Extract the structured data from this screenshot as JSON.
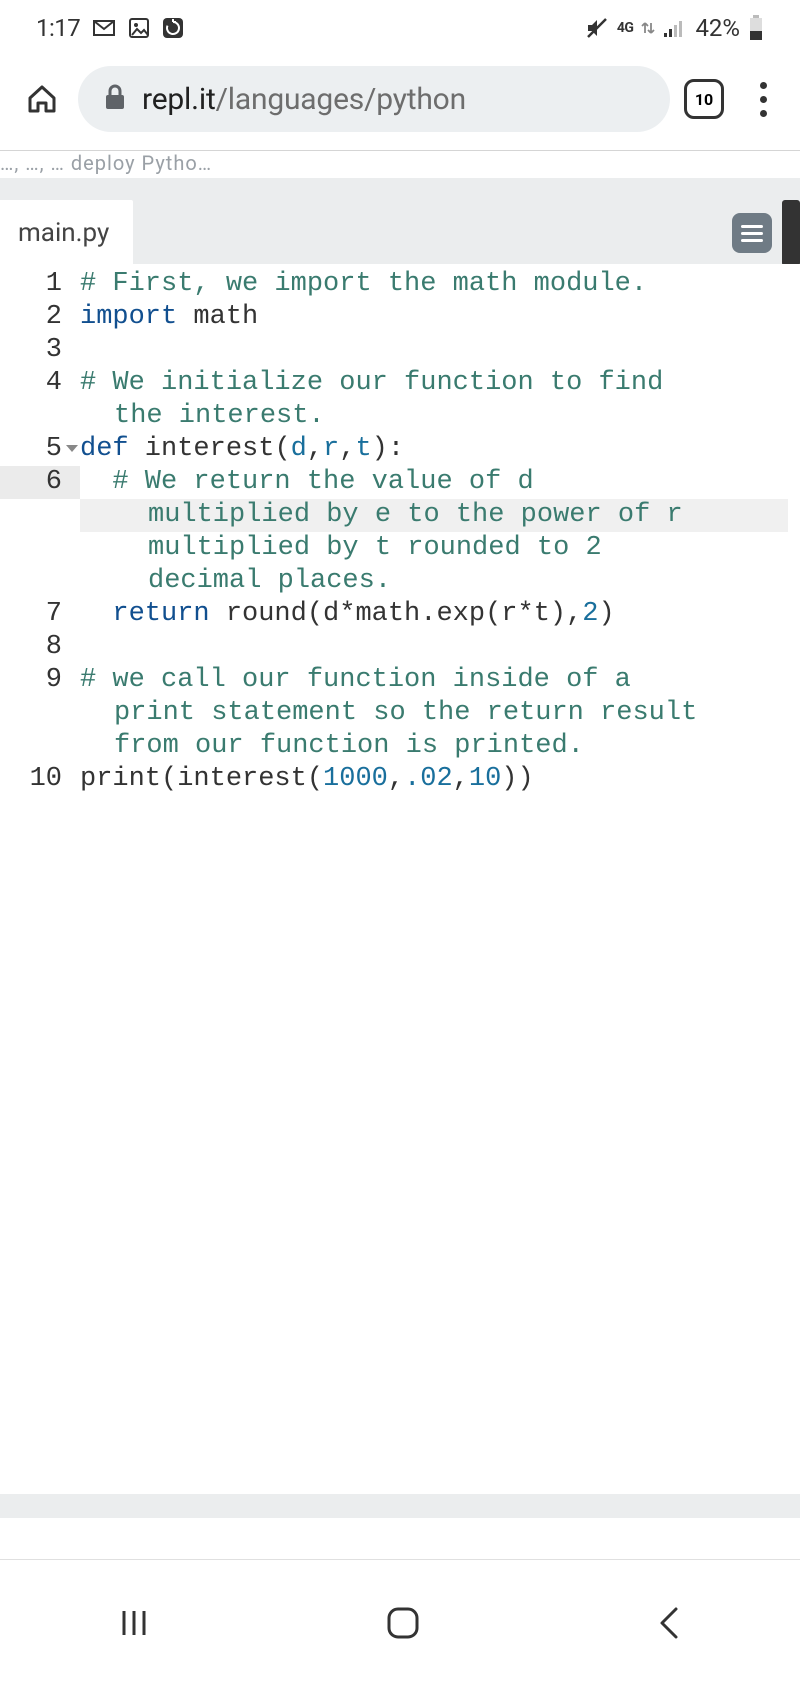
{
  "status": {
    "time": "1:17",
    "battery_pct": "42%",
    "network_label": "4G"
  },
  "browser": {
    "url_domain": "repl.it",
    "url_path": "/languages/python",
    "tab_count": "10"
  },
  "truncated_header": "…, …, … deploy Pytho…",
  "editor": {
    "filename": "main.py",
    "lines": {
      "l1_comment": "# First, we import the math module.",
      "l2_import": "import",
      "l2_module": " math",
      "l4_comment_a": "# We initialize our function to find",
      "l4_comment_b": "the interest.",
      "l5_def": "def",
      "l5_name": " interest",
      "l5_open": "(",
      "l5_p1": "d",
      "l5_c1": ",",
      "l5_p2": "r",
      "l5_c2": ",",
      "l5_p3": "t",
      "l5_close": "):",
      "l6_comment_a": "# We return the value of d",
      "l6_comment_b": "multiplied by e to the power of r",
      "l6_comment_c": "multiplied by t rounded to 2",
      "l6_comment_d": "decimal places.",
      "l7_return": "return",
      "l7_round": " round",
      "l7_open": "(",
      "l7_d": "d",
      "l7_star": "*",
      "l7_math": "math",
      "l7_dot": ".",
      "l7_exp": "exp",
      "l7_open2": "(",
      "l7_r": "r",
      "l7_star2": "*",
      "l7_t": "t",
      "l7_close2": ")",
      "l7_comma": ",",
      "l7_two": "2",
      "l7_close": ")",
      "l9_comment_a": "# we call our function inside of a",
      "l9_comment_b": "print statement so the return result",
      "l9_comment_c": "from our function is printed.",
      "l10_print": "print",
      "l10_open": "(",
      "l10_interest": "interest",
      "l10_open2": "(",
      "l10_n1": "1000",
      "l10_c1": ",",
      "l10_n2": ".02",
      "l10_c2": ",",
      "l10_n3": "10",
      "l10_close2": ")",
      "l10_close": ")"
    },
    "line_numbers": {
      "n1": "1",
      "n2": "2",
      "n3": "3",
      "n4": "4",
      "n5": "5",
      "n6": "6",
      "n7": "7",
      "n8": "8",
      "n9": "9",
      "n10": "10"
    }
  }
}
